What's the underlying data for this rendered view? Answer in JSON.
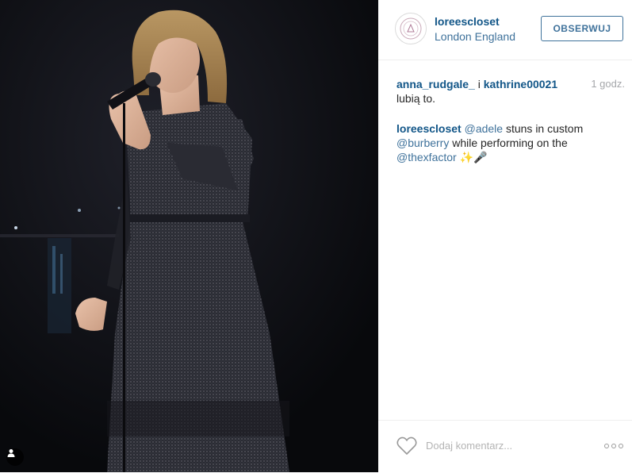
{
  "post": {
    "username": "loreescloset",
    "location": "London England",
    "follow_label": "OBSERWUJ",
    "likes": {
      "user1": "anna_rudgale_",
      "connector": "i",
      "user2": "kathrine00021",
      "suffix": "lubią to.",
      "time": "1 godz."
    },
    "caption": {
      "owner": "loreescloset",
      "mention1": "@adele",
      "text1": "stuns in custom",
      "mention2": "@burberry",
      "text2": "while performing on the",
      "mention3": "@thexfactor",
      "emoji": "✨🎤"
    },
    "comment_placeholder": "Dodaj komentarz..."
  },
  "icons": {
    "avatar": "profile-avatar-icon",
    "user_tag": "user-tag-icon",
    "like": "heart-icon",
    "more": "more-options-icon"
  },
  "colors": {
    "link": "#125688",
    "accent": "#3f729b",
    "muted": "#a5a7aa"
  }
}
